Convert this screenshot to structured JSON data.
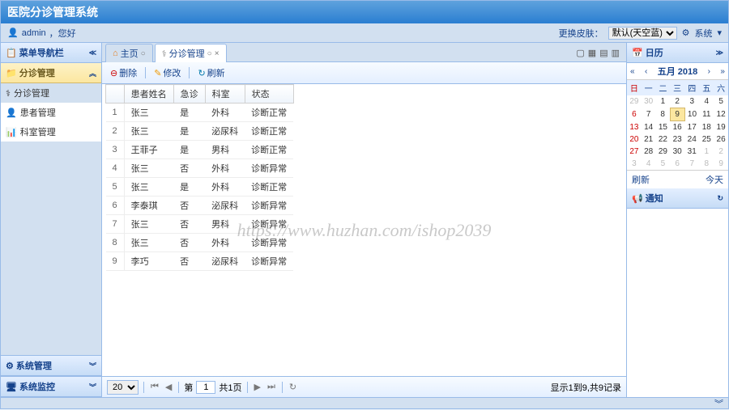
{
  "app_title": "医院分诊管理系统",
  "header": {
    "user": "admin",
    "greeting": "，您好",
    "skin_label": "更换皮肤：",
    "skin_value": "默认(天空蓝)",
    "sys_menu": "系统"
  },
  "nav": {
    "title": "菜单导航栏",
    "section1": "分诊管理",
    "items": [
      {
        "label": "分诊管理"
      },
      {
        "label": "患者管理"
      },
      {
        "label": "科室管理"
      }
    ],
    "bottom1": "系统管理",
    "bottom2": "系统监控"
  },
  "tabs": {
    "home": "主页",
    "current": "分诊管理"
  },
  "toolbar": {
    "delete": "删除",
    "edit": "修改",
    "refresh": "刷新"
  },
  "grid": {
    "cols": [
      "患者姓名",
      "急诊",
      "科室",
      "状态"
    ],
    "rows": [
      [
        "张三",
        "是",
        "外科",
        "诊断正常"
      ],
      [
        "张三",
        "是",
        "泌尿科",
        "诊断正常"
      ],
      [
        "王菲子",
        "是",
        "男科",
        "诊断正常"
      ],
      [
        "张三",
        "否",
        "外科",
        "诊断异常"
      ],
      [
        "张三",
        "是",
        "外科",
        "诊断正常"
      ],
      [
        "李泰琪",
        "否",
        "泌尿科",
        "诊断异常"
      ],
      [
        "张三",
        "否",
        "男科",
        "诊断异常"
      ],
      [
        "张三",
        "否",
        "外科",
        "诊断异常"
      ],
      [
        "李巧",
        "否",
        "泌尿科",
        "诊断异常"
      ]
    ]
  },
  "paging": {
    "page_size": "20",
    "page_label_pre": "第",
    "page_num": "1",
    "page_label_post": "共1页",
    "info": "显示1到9,共9记录"
  },
  "right": {
    "cal_title": "日历",
    "month": "五月 2018",
    "weekdays": [
      "日",
      "一",
      "二",
      "三",
      "四",
      "五",
      "六"
    ],
    "weeks": [
      [
        {
          "d": "29",
          "o": true
        },
        {
          "d": "30",
          "o": true
        },
        {
          "d": "1"
        },
        {
          "d": "2"
        },
        {
          "d": "3"
        },
        {
          "d": "4"
        },
        {
          "d": "5"
        }
      ],
      [
        {
          "d": "6"
        },
        {
          "d": "7"
        },
        {
          "d": "8"
        },
        {
          "d": "9",
          "t": true
        },
        {
          "d": "10"
        },
        {
          "d": "11"
        },
        {
          "d": "12"
        }
      ],
      [
        {
          "d": "13"
        },
        {
          "d": "14"
        },
        {
          "d": "15"
        },
        {
          "d": "16"
        },
        {
          "d": "17"
        },
        {
          "d": "18"
        },
        {
          "d": "19"
        }
      ],
      [
        {
          "d": "20"
        },
        {
          "d": "21"
        },
        {
          "d": "22"
        },
        {
          "d": "23"
        },
        {
          "d": "24"
        },
        {
          "d": "25"
        },
        {
          "d": "26"
        }
      ],
      [
        {
          "d": "27"
        },
        {
          "d": "28"
        },
        {
          "d": "29"
        },
        {
          "d": "30"
        },
        {
          "d": "31"
        },
        {
          "d": "1",
          "o": true
        },
        {
          "d": "2",
          "o": true
        }
      ],
      [
        {
          "d": "3",
          "o": true
        },
        {
          "d": "4",
          "o": true
        },
        {
          "d": "5",
          "o": true
        },
        {
          "d": "6",
          "o": true
        },
        {
          "d": "7",
          "o": true
        },
        {
          "d": "8",
          "o": true
        },
        {
          "d": "9",
          "o": true
        }
      ]
    ],
    "refresh": "刷新",
    "today": "今天",
    "notice_title": "通知"
  },
  "watermark": "https://www.huzhan.com/ishop2039"
}
